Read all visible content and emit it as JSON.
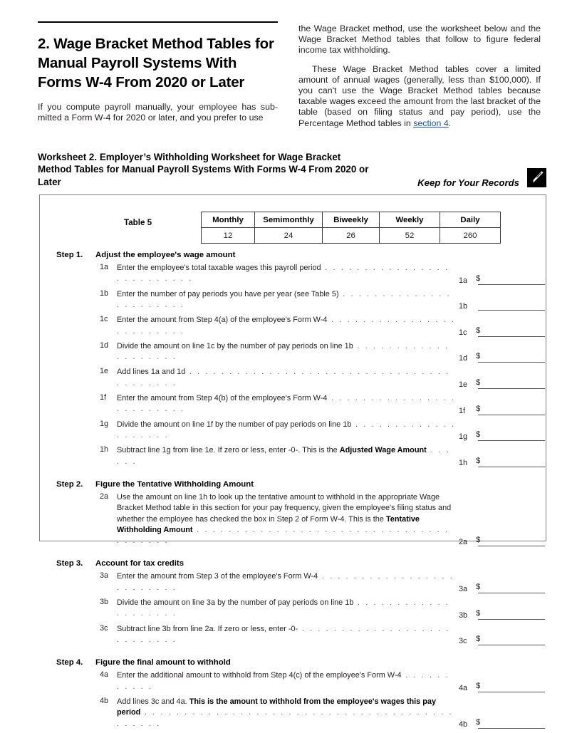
{
  "document": {
    "section_heading": "2. Wage Bracket Method Tables for Manual Payroll Systems With Forms W-4 From 2020 or Later",
    "left_intro": "If you compute payroll manually, your employee has sub-mitted a Form W-4 for 2020 or later, and you prefer to use",
    "right_paragraph_1": "the Wage Bracket method, use the worksheet below and the Wage Bracket Method tables that follow to figure federal income tax withholding.",
    "right_paragraph_2_pre": "These Wage Bracket Method tables cover a limited amount of annual wages (generally, less than $100,000). If you can't use the Wage Bracket Method tables because taxable wages exceed the amount from the last bracket of the table (based on filing status and pay period), use the Percentage Method tables in ",
    "right_paragraph_2_link": "section 4",
    "right_paragraph_2_post": ".",
    "link_color": "#1b53a6"
  },
  "worksheet": {
    "heading": "Worksheet 2. Employer’s Withholding Worksheet for Wage Bracket Method Tables for Manual Payroll Systems With Forms W-4 From 2020 or Later",
    "keep_for_records": "Keep for Your Records",
    "badge_icon": "pen-icon"
  },
  "table5": {
    "label": "Table 5",
    "headers": [
      "Monthly",
      "Semimonthly",
      "Biweekly",
      "Weekly",
      "Daily"
    ],
    "values": [
      "12",
      "24",
      "26",
      "52",
      "260"
    ]
  },
  "steps": [
    {
      "number": "Step 1.",
      "title": "Adjust the employee's wage amount",
      "lines": [
        {
          "id": "1a",
          "text": "Enter the employee's total taxable wages this payroll period",
          "leader": ". . . . . . . . . . . . . . . . . . . . . . . . . .",
          "ref": "1a",
          "dollar": "$",
          "double_rule": false
        },
        {
          "id": "1b",
          "text": "Enter the number of pay periods you have per year (see Table 5)",
          "leader": ". . . . . . . . . . . . . . . . . . . . . . .",
          "ref": "1b",
          "dollar": "",
          "double_rule": false
        },
        {
          "id": "1c",
          "text": "Enter the amount from Step 4(a) of the employee's Form W-4",
          "leader": ". . . . . . . . . . . . . . . . . . . . . . . . .",
          "ref": "1c",
          "dollar": "$",
          "double_rule": false
        },
        {
          "id": "1d",
          "text": "Divide the amount on line 1c by the number of pay periods on line 1b",
          "leader": ". . . . . . . . . . . . . . . . . . . .",
          "ref": "1d",
          "dollar": "$",
          "double_rule": false
        },
        {
          "id": "1e",
          "text": "Add lines 1a and 1d",
          "leader": ". . . . . . . . . . . . . . . . . . . . . . . . . . . . . . . . . . . . . . . . .",
          "ref": "1e",
          "dollar": "$",
          "double_rule": false
        },
        {
          "id": "1f",
          "text": "Enter the amount from Step 4(b) of the employee's Form W-4",
          "leader": ". . . . . . . . . . . . . . . . . . . . . . . . .",
          "ref": "1f",
          "dollar": "$",
          "double_rule": false
        },
        {
          "id": "1g",
          "text": "Divide the amount on line 1f by the number of pay periods on line 1b",
          "leader": ". . . . . . . . . . . . . . . . . . . .",
          "ref": "1g",
          "dollar": "$",
          "double_rule": false
        },
        {
          "id": "1h",
          "text_pre": "Subtract line 1g from line 1e. If zero or less, enter -0-. This is the ",
          "text_bold": "Adjusted Wage Amount",
          "leader": ". . . . . .",
          "ref": "1h",
          "dollar": "$",
          "double_rule": false
        }
      ]
    },
    {
      "number": "Step 2.",
      "title": "Figure the Tentative Withholding Amount",
      "lines": [
        {
          "id": "2a",
          "text_pre": "Use the amount on line 1h to look up the tentative amount to withhold in the appropriate Wage Bracket Method table in this section for your pay frequency, given the employee's filing status and whether the employee has checked the box in Step 2 of Form W-4. This is the ",
          "text_bold": "Tentative Withholding Amount",
          "leader": ". . . . . . . . . . . . . . . . . . . . . . . . . . . . . . . . . . . . . . .",
          "ref": "2a",
          "dollar": "$",
          "double_rule": false
        }
      ]
    },
    {
      "number": "Step 3.",
      "title": "Account for tax credits",
      "lines": [
        {
          "id": "3a",
          "text": "Enter the amount from Step 3 of the employee's Form W-4",
          "leader": ". . . . . . . . . . . . . . . . . . . . . . . . .",
          "ref": "3a",
          "dollar": "$",
          "double_rule": false
        },
        {
          "id": "3b",
          "text": "Divide the amount on line 3a by the number of pay periods on line 1b",
          "leader": ". . . . . . . . . . . . . . . . . . . .",
          "ref": "3b",
          "dollar": "$",
          "double_rule": false
        },
        {
          "id": "3c",
          "text": "Subtract line 3b from line 2a. If zero or less, enter -0-",
          "leader": ". . . . . . . . . . . . . . . . . . . . . . . . . . .",
          "ref": "3c",
          "dollar": "$",
          "double_rule": false
        }
      ]
    },
    {
      "number": "Step 4.",
      "title": "Figure the final amount to withhold",
      "lines": [
        {
          "id": "4a",
          "text": "Enter the additional amount to withhold from Step 4(c) of the employee's Form W-4",
          "leader": ". . . . . . . . . . .",
          "ref": "4a",
          "dollar": "$",
          "double_rule": false
        },
        {
          "id": "4b",
          "text_pre": "Add lines 3c and 4a. ",
          "text_bold": "This is the amount to withhold from the employee's wages this pay period",
          "leader": ". . . . . . . . . . . . . . . . . . . . . . . . . . . . . . . . . . . . . . . . . . . . .",
          "ref": "4b",
          "dollar": "$",
          "double_rule": true
        }
      ]
    }
  ]
}
